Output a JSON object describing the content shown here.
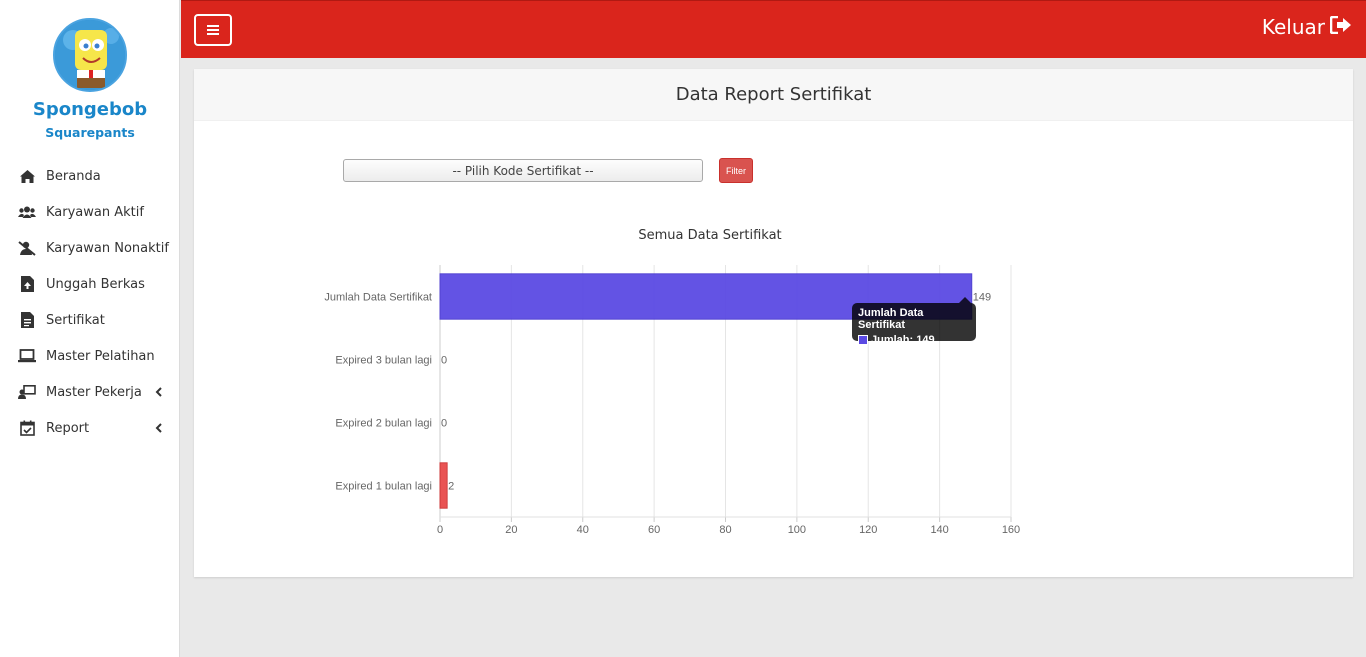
{
  "user": {
    "first_name": "Spongebob",
    "last_name": "Squarepants"
  },
  "sidebar": {
    "items": [
      {
        "label": "Beranda",
        "icon": "home-icon"
      },
      {
        "label": "Karyawan Aktif",
        "icon": "users-icon"
      },
      {
        "label": "Karyawan Nonaktif",
        "icon": "user-slash-icon"
      },
      {
        "label": "Unggah Berkas",
        "icon": "file-upload-icon"
      },
      {
        "label": "Sertifikat",
        "icon": "file-text-icon"
      },
      {
        "label": "Master Pelatihan",
        "icon": "laptop-icon"
      },
      {
        "label": "Master Pekerja",
        "icon": "user-board-icon",
        "has_submenu": true
      },
      {
        "label": "Report",
        "icon": "calendar-check-icon",
        "has_submenu": true
      }
    ]
  },
  "header": {
    "logout_label": "Keluar",
    "logout_icon": "sign-out-icon",
    "menu_icon": "hamburger-icon"
  },
  "colors": {
    "header": "#da251c",
    "accent": "#1a86c9",
    "bar_primary": "#5b4ae3",
    "bar_alert": "#e84a4a",
    "filter_button": "#d9534f"
  },
  "page": {
    "title": "Data Report Sertifikat"
  },
  "filter": {
    "select_value": "-- Pilih Kode Sertifikat --",
    "button_label": "Filter"
  },
  "chart_data": {
    "type": "bar",
    "orientation": "horizontal",
    "title": "Semua Data Sertifikat",
    "categories": [
      "Jumlah Data Sertifikat",
      "Expired 3 bulan lagi",
      "Expired 2 bulan lagi",
      "Expired 1 bulan lagi"
    ],
    "series": [
      {
        "name": "Jumlah",
        "values": [
          149,
          0,
          0,
          2
        ],
        "colors": [
          "#5b4ae3",
          "#e84a4a",
          "#e84a4a",
          "#e84a4a"
        ]
      }
    ],
    "xlim": [
      0,
      160
    ],
    "xticks": [
      0,
      20,
      40,
      60,
      80,
      100,
      120,
      140,
      160
    ],
    "grid": true,
    "data_labels": true
  },
  "tooltip": {
    "title": "Jumlah Data Sertifikat",
    "label": "Jumlah: 149"
  }
}
